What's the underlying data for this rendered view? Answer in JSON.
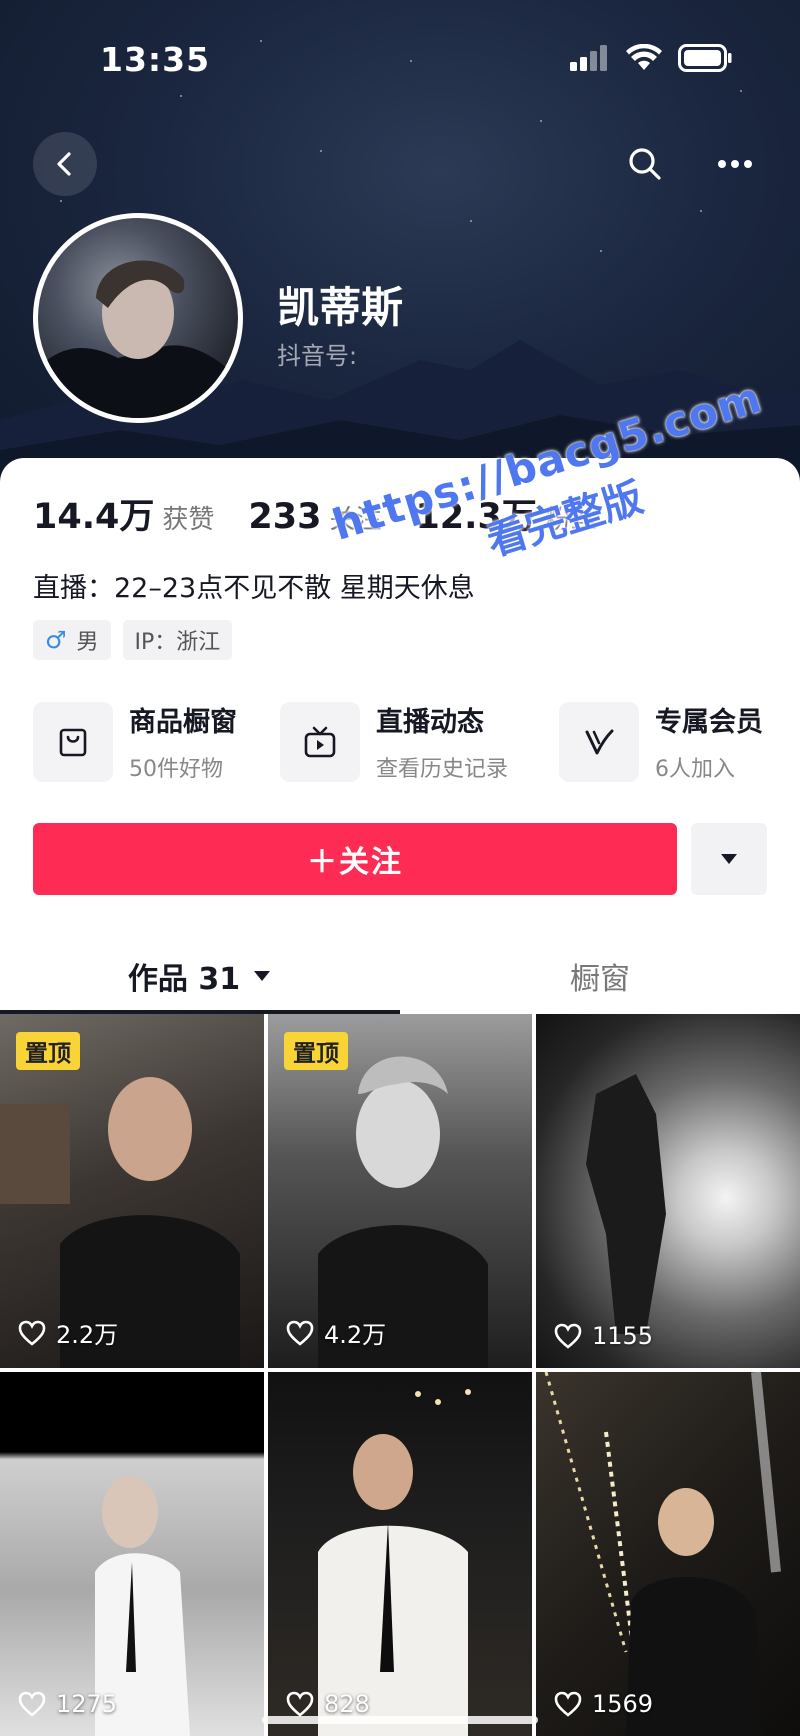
{
  "status_bar": {
    "time": "13:35"
  },
  "profile": {
    "name": "凯蒂斯",
    "douyin_id_label": "抖音号:"
  },
  "stats": [
    {
      "value": "14.4万",
      "label": "获赞"
    },
    {
      "value": "233",
      "label": "关注"
    },
    {
      "value": "12.3万",
      "label": "粉丝"
    }
  ],
  "bio": "直播：22–23点不见不散 星期天休息",
  "tags": {
    "gender": "男",
    "gender_symbol": "♂",
    "ip": "IP：浙江"
  },
  "shortcuts": [
    {
      "title": "商品橱窗",
      "subtitle": "50件好物",
      "icon": "bag-icon"
    },
    {
      "title": "直播动态",
      "subtitle": "查看历史记录",
      "icon": "tv-icon"
    },
    {
      "title": "专属会员",
      "subtitle": "6人加入",
      "icon": "v-icon"
    }
  ],
  "follow_button": {
    "label": "＋关注"
  },
  "tabs": {
    "works": "作品 31",
    "window": "橱窗"
  },
  "videos": [
    {
      "pinned": "置顶",
      "likes": "2.2万"
    },
    {
      "pinned": "置顶",
      "likes": "4.2万"
    },
    {
      "pinned": "",
      "likes": "1155"
    },
    {
      "pinned": "",
      "likes": "1275"
    },
    {
      "pinned": "",
      "likes": "828"
    },
    {
      "pinned": "",
      "likes": "1569"
    }
  ],
  "watermark": {
    "url": "https://bacg5.com",
    "text": "看完整版"
  },
  "colors": {
    "follow": "#fe2c55",
    "pin_badge": "#f8d436",
    "watermark": "#4f78f0",
    "header_bg": "#1b2740"
  }
}
